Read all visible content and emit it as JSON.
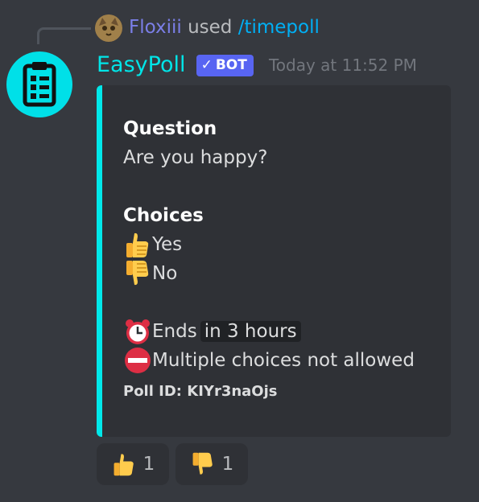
{
  "reply": {
    "username": "Floxiii",
    "verb": "used",
    "command": "/timepoll"
  },
  "message": {
    "author": "EasyPoll",
    "bot_tag": "BOT",
    "bot_check": "✓",
    "timestamp": "Today at 11:52 PM"
  },
  "embed": {
    "accent_color": "#00e8ea",
    "question_label": "Question",
    "question": "Are you happy?",
    "choices_label": "Choices",
    "choices": [
      "Yes",
      "No"
    ],
    "ends_prefix": "Ends",
    "ends_time": "in 3 hours",
    "multiple_choice_text": "Multiple choices not allowed",
    "footer": "Poll ID: KIYr3naOjs"
  },
  "reactions": [
    {
      "icon": "thumbs-up-icon",
      "count": "1"
    },
    {
      "icon": "thumbs-down-icon",
      "count": "1"
    }
  ]
}
